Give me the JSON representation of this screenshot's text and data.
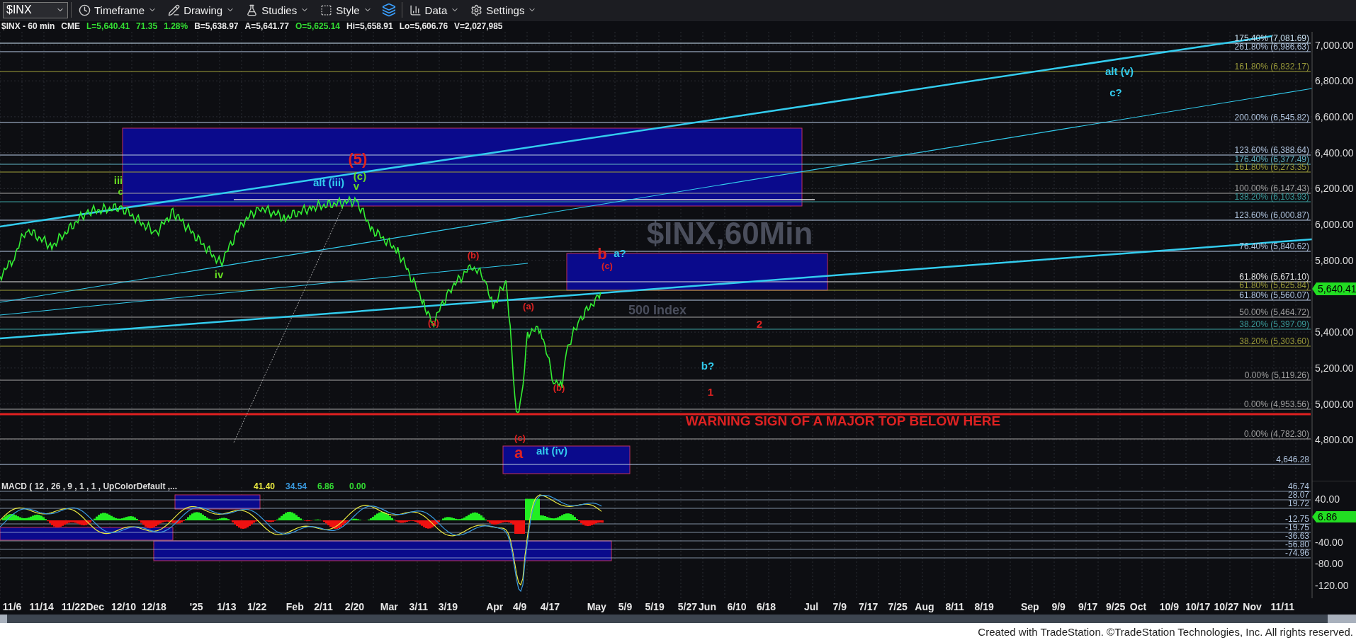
{
  "toolbar": {
    "symbol": "$INX",
    "menus": [
      {
        "label": "Timeframe"
      },
      {
        "label": "Drawing"
      },
      {
        "label": "Studies"
      },
      {
        "label": "Style"
      },
      {
        "label": "Data"
      },
      {
        "label": "Settings"
      }
    ]
  },
  "quote_bar": [
    {
      "text": "$INX - 60 min",
      "color": "#e8e8e8"
    },
    {
      "text": "CME",
      "color": "#e8e8e8"
    },
    {
      "text": "L=5,640.41",
      "color": "#33dd33"
    },
    {
      "text": "71.35",
      "color": "#33dd33"
    },
    {
      "text": "1.28%",
      "color": "#33dd33"
    },
    {
      "text": "B=5,638.97",
      "color": "#e8e8e8"
    },
    {
      "text": "A=5,641.77",
      "color": "#e8e8e8"
    },
    {
      "text": "O=5,625.14",
      "color": "#33dd33"
    },
    {
      "text": "Hi=5,658.91",
      "color": "#e8e8e8"
    },
    {
      "text": "Lo=5,606.76",
      "color": "#e8e8e8"
    },
    {
      "text": "V=2,027,985",
      "color": "#e8e8e8"
    }
  ],
  "price_chart": {
    "watermark": [
      "$INX,60Min",
      "500 Index"
    ],
    "fib_levels": [
      {
        "label": "175.40% (7,081.69)",
        "color": "#c8e0f0"
      },
      {
        "label": "261.80% (6,986.63)",
        "color": "#b0c4de"
      },
      {
        "label": "161.80% (6,832.17)",
        "color": "#9a9a3a"
      },
      {
        "label": "200.00% (6,545.82)",
        "color": "#b0c4de"
      },
      {
        "label": "123.60% (6,388.64)",
        "color": "#b0c4de"
      },
      {
        "label": "176.40% (6,377.49)",
        "color": "#5fb0c0"
      },
      {
        "label": "161.80% (6,273.35)",
        "color": "#9a9a3a"
      },
      {
        "label": "100.00% (6,147.43)",
        "color": "#a0a0a0"
      },
      {
        "label": "138.20% (6,103.93)",
        "color": "#3a9a9a"
      },
      {
        "label": "123.60% (6,000.87)",
        "color": "#b0c4de"
      },
      {
        "label": "76.40% (5,840.62)",
        "color": "#b0c4de"
      },
      {
        "label": "61.80% (5,671.10)",
        "color": "#e0e0e0"
      },
      {
        "label": "61.80% (5,625.84)",
        "color": "#9a9a3a"
      },
      {
        "label": "61.80% (5,560.07)",
        "color": "#b0c4de"
      },
      {
        "label": "50.00% (5,464.72)",
        "color": "#a0a0a0"
      },
      {
        "label": "38.20% (5,397.09)",
        "color": "#3a9a9a"
      },
      {
        "label": "38.20% (5,303.60)",
        "color": "#9a9a3a"
      },
      {
        "label": "0.00% (5,119.26)",
        "color": "#a0a0a0"
      },
      {
        "label": "0.00% (4,953.56)",
        "color": "#a0a0a0"
      },
      {
        "label": "0.00% (4,782.30)",
        "color": "#a0a0a0"
      },
      {
        "label": "4,646.28",
        "color": "#b0c4de"
      }
    ],
    "wave_labels": [
      {
        "text": "iii",
        "color": "#66dd22",
        "kind": "major"
      },
      {
        "text": "c",
        "color": "#66dd22",
        "kind": "minor"
      },
      {
        "text": "iv",
        "color": "#66dd22",
        "kind": "major"
      },
      {
        "text": "(5)",
        "color": "#dd2222",
        "kind": "big"
      },
      {
        "text": "(c)",
        "color": "#66dd22",
        "kind": "major"
      },
      {
        "text": "alt (iii)",
        "color": "#33ccee",
        "kind": "major"
      },
      {
        "text": "v",
        "color": "#66dd22",
        "kind": "major"
      },
      {
        "text": "(b)",
        "color": "#dd2222",
        "kind": "minor"
      },
      {
        "text": "(a)",
        "color": "#dd2222",
        "kind": "minor"
      },
      {
        "text": "(a)",
        "color": "#dd2222",
        "kind": "minor"
      },
      {
        "text": "(b)",
        "color": "#dd2222",
        "kind": "minor"
      },
      {
        "text": "(c)",
        "color": "#dd2222",
        "kind": "minor"
      },
      {
        "text": "a",
        "color": "#dd2222",
        "kind": "big"
      },
      {
        "text": "alt (iv)",
        "color": "#33ccee",
        "kind": "major"
      },
      {
        "text": "b",
        "color": "#dd2222",
        "kind": "big"
      },
      {
        "text": "a?",
        "color": "#33ccee",
        "kind": "major"
      },
      {
        "text": "(c)",
        "color": "#dd2222",
        "kind": "minor"
      },
      {
        "text": "2",
        "color": "#dd2222",
        "kind": "major"
      },
      {
        "text": "b?",
        "color": "#33ccee",
        "kind": "major"
      },
      {
        "text": "1",
        "color": "#dd2222",
        "kind": "major"
      },
      {
        "text": "WARNING SIGN OF A MAJOR TOP BELOW HERE",
        "color": "#dd2222",
        "kind": "warning"
      },
      {
        "text": "alt (v)",
        "color": "#33ccee",
        "kind": "major"
      },
      {
        "text": "c?",
        "color": "#33ccee",
        "kind": "major"
      }
    ],
    "price_axis": [
      "7,000.00",
      "6,800.00",
      "6,600.00",
      "6,400.00",
      "6,200.00",
      "6,000.00",
      "5,800.00",
      "5,400.00",
      "5,200.00",
      "5,000.00",
      "4,800.00"
    ],
    "last_price": "5,640.41"
  },
  "macd": {
    "title": "MACD ( 12 , 26 , 9 , 1 , 1 , UpColorDefault ,...",
    "values": [
      {
        "text": "41.40",
        "color": "#e8e840"
      },
      {
        "text": "34.54",
        "color": "#3a9ae0"
      },
      {
        "text": "6.86",
        "color": "#33dd33"
      },
      {
        "text": "0.00",
        "color": "#33dd33"
      }
    ],
    "levels": [
      "46.74",
      "28.07",
      "19.72",
      "-12.75",
      "-19.75",
      "-36.63",
      "-56.80",
      "-74.96"
    ],
    "axis": [
      "40.00",
      "-40.00",
      "-80.00",
      "-120.00"
    ],
    "last_value": "6.86"
  },
  "time_axis": [
    "11/6",
    "11/14",
    "11/22",
    "Dec",
    "12/10",
    "12/18",
    "'25",
    "1/13",
    "1/22",
    "Feb",
    "2/11",
    "2/20",
    "Mar",
    "3/11",
    "3/19",
    "Apr",
    "4/9",
    "4/17",
    "May",
    "5/9",
    "5/19",
    "5/27",
    "Jun",
    "6/10",
    "6/18",
    "Jul",
    "7/9",
    "7/17",
    "7/25",
    "Aug",
    "8/11",
    "8/19",
    "Sep",
    "9/9",
    "9/17",
    "9/25",
    "Oct",
    "10/9",
    "10/17",
    "10/27",
    "Nov",
    "11/11"
  ],
  "footer": "Created with TradeStation. ©TradeStation Technologies, Inc. All rights reserved."
}
